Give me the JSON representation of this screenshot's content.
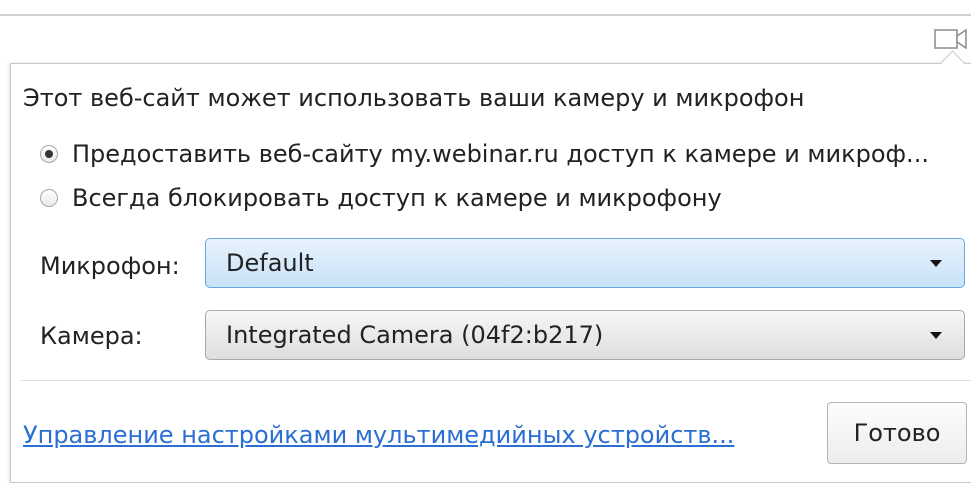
{
  "bubble": {
    "title": "Этот веб-сайт может использовать ваши камеру и микрофон",
    "options": [
      {
        "label": "Предоставить веб-сайту my.webinar.ru доступ к камере и микроф...",
        "selected": true
      },
      {
        "label": "Всегда блокировать доступ к камере и микрофону",
        "selected": false
      }
    ],
    "microphone": {
      "label": "Микрофон:",
      "value": "Default"
    },
    "camera": {
      "label": "Камера:",
      "value": "Integrated Camera (04f2:b217)"
    },
    "manage_link": "Управление настройками мультимедийных устройств...",
    "done_label": "Готово"
  },
  "icons": {
    "toolbar": "camera-icon",
    "dropdown": "triangle-down"
  },
  "colors": {
    "link": "#2a6fd1",
    "focus_border": "#6aa8df"
  }
}
